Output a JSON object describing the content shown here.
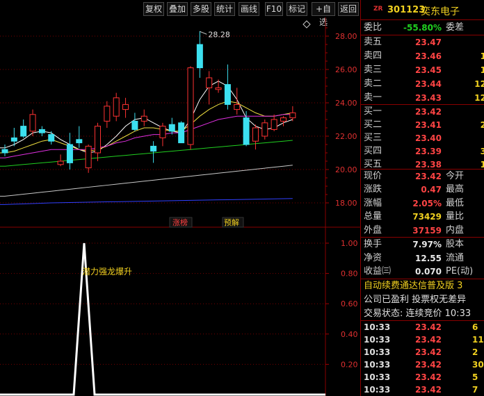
{
  "toolbar": {
    "buttons": [
      "复权",
      "叠加",
      "多股",
      "统计",
      "画线",
      "F10",
      "标记",
      "+自选",
      "返回"
    ]
  },
  "chart": {
    "price_axis_ticks": [
      "28.00",
      "26.00",
      "24.00",
      "22.00",
      "20.00",
      "18.00"
    ],
    "indicator_axis_ticks": [
      "1.00",
      "0.80",
      "0.60",
      "0.40",
      "0.20"
    ],
    "high_marker": "28.28",
    "badge_limit_up": "涨榜",
    "badge_forecast": "预解",
    "signal_label": "潜力强龙爆升",
    "diamond_icon": "diamond-icon"
  },
  "chart_data": [
    {
      "type": "candlestick",
      "ylim": [
        17.5,
        29.5
      ],
      "candles": [
        {
          "o": 21.2,
          "h": 21.5,
          "l": 20.8,
          "c": 21.0
        },
        {
          "o": 21.9,
          "h": 22.5,
          "l": 21.4,
          "c": 21.7
        },
        {
          "o": 22.6,
          "h": 23.0,
          "l": 21.9,
          "c": 22.0
        },
        {
          "o": 22.3,
          "h": 23.6,
          "l": 22.0,
          "c": 23.3
        },
        {
          "o": 22.4,
          "h": 22.6,
          "l": 22.0,
          "c": 22.2
        },
        {
          "o": 22.1,
          "h": 22.3,
          "l": 21.5,
          "c": 21.7
        },
        {
          "o": 20.3,
          "h": 20.9,
          "l": 20.2,
          "c": 20.5
        },
        {
          "o": 21.5,
          "h": 22.2,
          "l": 20.0,
          "c": 20.4
        },
        {
          "o": 21.8,
          "h": 22.6,
          "l": 21.3,
          "c": 21.6
        },
        {
          "o": 20.1,
          "h": 21.5,
          "l": 19.8,
          "c": 21.4
        },
        {
          "o": 21.0,
          "h": 22.8,
          "l": 20.5,
          "c": 22.6
        },
        {
          "o": 22.9,
          "h": 24.1,
          "l": 22.5,
          "c": 23.8
        },
        {
          "o": 23.2,
          "h": 24.6,
          "l": 22.9,
          "c": 24.3
        },
        {
          "o": 23.6,
          "h": 24.3,
          "l": 23.1,
          "c": 23.9
        },
        {
          "o": 22.9,
          "h": 23.4,
          "l": 22.3,
          "c": 22.4
        },
        {
          "o": 22.9,
          "h": 23.6,
          "l": 22.6,
          "c": 23.2
        },
        {
          "o": 21.4,
          "h": 21.7,
          "l": 20.4,
          "c": 21.1
        },
        {
          "o": 21.9,
          "h": 22.8,
          "l": 21.4,
          "c": 22.6
        },
        {
          "o": 22.7,
          "h": 23.1,
          "l": 22.1,
          "c": 22.3
        },
        {
          "o": 22.8,
          "h": 22.9,
          "l": 21.7,
          "c": 21.6
        },
        {
          "o": 21.5,
          "h": 26.2,
          "l": 21.2,
          "c": 26.1
        },
        {
          "o": 27.5,
          "h": 28.3,
          "l": 25.5,
          "c": 26.1
        },
        {
          "o": 24.9,
          "h": 25.9,
          "l": 23.9,
          "c": 25.5
        },
        {
          "o": 24.8,
          "h": 25.4,
          "l": 24.6,
          "c": 24.9
        },
        {
          "o": 25.1,
          "h": 26.3,
          "l": 23.6,
          "c": 23.9
        },
        {
          "o": 23.6,
          "h": 24.9,
          "l": 23.3,
          "c": 23.9
        },
        {
          "o": 23.1,
          "h": 23.5,
          "l": 21.4,
          "c": 21.5
        },
        {
          "o": 21.7,
          "h": 22.7,
          "l": 21.2,
          "c": 22.5
        },
        {
          "o": 22.0,
          "h": 23.0,
          "l": 21.8,
          "c": 22.8
        },
        {
          "o": 22.4,
          "h": 23.3,
          "l": 22.3,
          "c": 23.0
        },
        {
          "o": 22.9,
          "h": 23.2,
          "l": 22.6,
          "c": 23.1
        },
        {
          "o": 23.1,
          "h": 23.8,
          "l": 22.9,
          "c": 23.4
        }
      ],
      "moving_averages": [
        {
          "color": "#ffffff",
          "values": [
            21.3,
            21.5,
            21.8,
            22.2,
            22.3,
            22.2,
            21.8,
            21.5,
            21.2,
            21.0,
            21.1,
            21.5,
            22.0,
            22.6,
            23.0,
            23.1,
            22.8,
            22.5,
            22.3,
            22.2,
            23.0,
            24.2,
            25.0,
            25.3,
            25.0,
            24.2,
            23.1,
            22.6,
            22.4,
            22.5,
            22.8,
            23.0
          ]
        },
        {
          "color": "#f0e040",
          "values": [
            21.0,
            21.1,
            21.3,
            21.5,
            21.7,
            21.8,
            21.6,
            21.4,
            21.2,
            21.1,
            21.2,
            21.4,
            21.7,
            22.0,
            22.3,
            22.5,
            22.5,
            22.4,
            22.3,
            22.3,
            22.7,
            23.2,
            23.6,
            23.9,
            24.1,
            24.0,
            23.7,
            23.4,
            23.2,
            23.2,
            23.3,
            23.4
          ]
        },
        {
          "color": "#e030e0",
          "values": [
            20.7,
            20.8,
            20.9,
            21.0,
            21.1,
            21.2,
            21.2,
            21.2,
            21.2,
            21.2,
            21.3,
            21.4,
            21.6,
            21.7,
            21.9,
            22.0,
            22.1,
            22.1,
            22.2,
            22.2,
            22.4,
            22.6,
            22.8,
            23.0,
            23.1,
            23.2,
            23.2,
            23.2,
            23.2,
            23.2,
            23.3,
            23.3
          ]
        },
        {
          "color": "#20d020",
          "values": [
            20.2,
            20.25,
            20.3,
            20.35,
            20.4,
            20.45,
            20.5,
            20.55,
            20.6,
            20.65,
            20.7,
            20.75,
            20.8,
            20.85,
            20.9,
            20.95,
            21.0,
            21.05,
            21.1,
            21.15,
            21.2,
            21.25,
            21.3,
            21.35,
            21.4,
            21.45,
            21.5,
            21.55,
            21.6,
            21.65,
            21.7,
            21.75
          ]
        },
        {
          "color": "#c8c8c8",
          "values": [
            18.4,
            18.46,
            18.52,
            18.58,
            18.64,
            18.7,
            18.76,
            18.82,
            18.88,
            18.94,
            19.0,
            19.06,
            19.12,
            19.18,
            19.24,
            19.3,
            19.36,
            19.42,
            19.48,
            19.54,
            19.6,
            19.66,
            19.72,
            19.78,
            19.84,
            19.9,
            19.96,
            20.02,
            20.08,
            20.14,
            20.2,
            20.26
          ]
        },
        {
          "color": "#3040ff",
          "values": [
            17.9,
            17.92,
            17.94,
            17.96,
            17.98,
            18.0,
            18.01,
            18.02,
            18.03,
            18.04,
            18.05,
            18.06,
            18.07,
            18.08,
            18.09,
            18.1,
            18.11,
            18.12,
            18.13,
            18.14,
            18.15,
            18.16,
            18.17,
            18.18,
            18.19,
            18.2,
            18.21,
            18.22,
            18.23,
            18.24,
            18.25,
            18.26
          ]
        }
      ]
    },
    {
      "type": "line",
      "ylim": [
        0,
        1.1
      ],
      "values": [
        0,
        0,
        0,
        0,
        0,
        0,
        0,
        0,
        0,
        0,
        0,
        0,
        0,
        0,
        0,
        0,
        0,
        0,
        0,
        0,
        0,
        0,
        0,
        0,
        0,
        0,
        0,
        1,
        0,
        0,
        0,
        0,
        0,
        0,
        0,
        0,
        0,
        0,
        0,
        0,
        0,
        0,
        0,
        0,
        0,
        0,
        0,
        0,
        0,
        0,
        0,
        0,
        0,
        0,
        0,
        0,
        0,
        0,
        0,
        0,
        0,
        0,
        0,
        0,
        0
      ]
    }
  ],
  "quote": {
    "flag": "ZR",
    "code": "301123",
    "name": "奕东电子",
    "weibi_label": "委比",
    "weibi_value": "-55.80%",
    "weicha_label": "委差",
    "asks": [
      {
        "label": "卖五",
        "price": "23.47",
        "vol": ""
      },
      {
        "label": "卖四",
        "price": "23.46",
        "vol": "1"
      },
      {
        "label": "卖三",
        "price": "23.45",
        "vol": "1"
      },
      {
        "label": "卖二",
        "price": "23.44",
        "vol": "12"
      },
      {
        "label": "卖一",
        "price": "23.43",
        "vol": "12"
      }
    ],
    "bids": [
      {
        "label": "买一",
        "price": "23.42",
        "vol": ""
      },
      {
        "label": "买二",
        "price": "23.41",
        "vol": "2"
      },
      {
        "label": "买三",
        "price": "23.40",
        "vol": ""
      },
      {
        "label": "买四",
        "price": "23.39",
        "vol": "3"
      },
      {
        "label": "买五",
        "price": "23.38",
        "vol": "1"
      }
    ],
    "stats": [
      {
        "label": "现价",
        "value": "23.42",
        "label2": "今开",
        "cls": "red"
      },
      {
        "label": "涨跌",
        "value": "0.47",
        "label2": "最高",
        "cls": "red"
      },
      {
        "label": "涨幅",
        "value": "2.05%",
        "label2": "最低",
        "cls": "red"
      },
      {
        "label": "总量",
        "value": "73429",
        "label2": "量比",
        "cls": "yellow"
      },
      {
        "label": "外盘",
        "value": "37159",
        "label2": "内盘",
        "cls": "red"
      }
    ],
    "fundamentals": [
      {
        "label": "换手",
        "value": "7.97%",
        "label2": "股本"
      },
      {
        "label": "净资",
        "value": "12.55",
        "label2": "流通"
      },
      {
        "label": "收益㈢",
        "value": "0.070",
        "label2": "PE(动)"
      }
    ],
    "info_lines": [
      "自动续费通达信普及版 3",
      "公司已盈利 投票权无差异",
      "交易状态: 连续竞价 10:33"
    ],
    "ticks": [
      {
        "time": "10:33",
        "price": "23.42",
        "vol": "6"
      },
      {
        "time": "10:33",
        "price": "23.42",
        "vol": "11"
      },
      {
        "time": "10:33",
        "price": "23.42",
        "vol": "2"
      },
      {
        "time": "10:33",
        "price": "23.42",
        "vol": "30"
      },
      {
        "time": "10:33",
        "price": "23.42",
        "vol": "5"
      },
      {
        "time": "10:33",
        "price": "23.42",
        "vol": "7"
      }
    ]
  }
}
